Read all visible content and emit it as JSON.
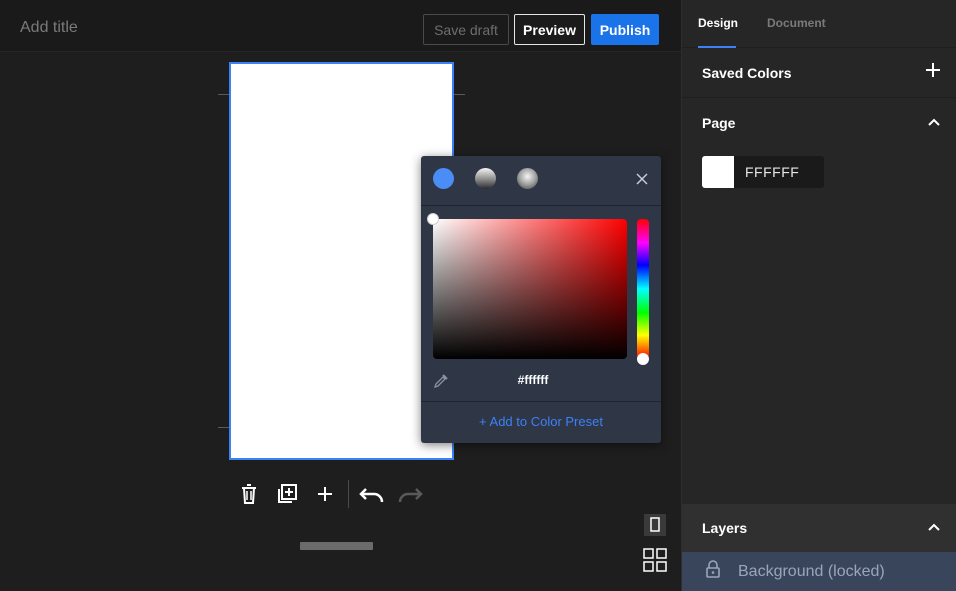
{
  "header": {
    "title_placeholder": "Add title",
    "save_draft_label": "Save draft",
    "preview_label": "Preview",
    "publish_label": "Publish"
  },
  "toolbar": {
    "icons": [
      "trash-icon",
      "duplicate-icon",
      "plus-icon",
      "undo-icon",
      "redo-icon"
    ]
  },
  "color_picker": {
    "hex_value": "#ffffff",
    "add_preset_label": "+ Add to Color Preset",
    "fill_types": [
      "solid",
      "linear-gradient",
      "radial-gradient"
    ],
    "selected_fill_type": "solid"
  },
  "panel": {
    "tabs": [
      {
        "label": "Design",
        "active": true
      },
      {
        "label": "Document",
        "active": false
      }
    ],
    "saved_colors_title": "Saved Colors",
    "page_title": "Page",
    "page_color_hex": "FFFFFF",
    "layers_title": "Layers",
    "layers": [
      {
        "label": "Background (locked)",
        "locked": true
      }
    ]
  },
  "colors": {
    "accent": "#1a73e8",
    "selection": "#3b82f6",
    "page_background": "#ffffff",
    "popover_bg": "#2f3646"
  }
}
